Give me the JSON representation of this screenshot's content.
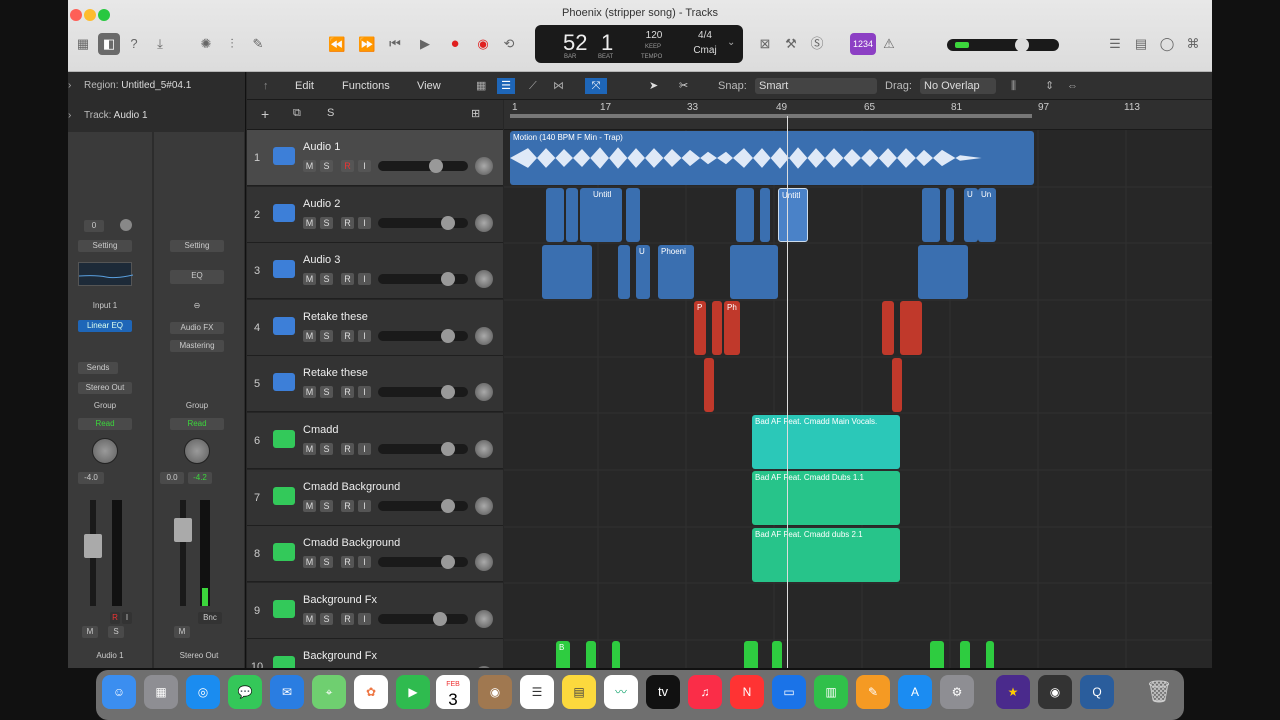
{
  "window": {
    "title": "Phoenix (stripper song) - Tracks"
  },
  "lcd": {
    "bar": "52",
    "beat": "1",
    "bar_label": "BAR",
    "beat_label": "BEAT",
    "tempo": "120",
    "keep": "KEEP",
    "tempo_label": "TEMPO",
    "signature": "4/4",
    "key": "Cmaj",
    "count_badge": "1234"
  },
  "inspector": {
    "region_prefix": "Region:",
    "region": "Untitled_5#04.1",
    "track_prefix": "Track:",
    "track": "Audio 1"
  },
  "channel_strip_1": {
    "gain": "0",
    "setting": "Setting",
    "input": "Input 1",
    "plugin": "Linear EQ",
    "sends": "Sends",
    "output": "Stereo Out",
    "group": "Group",
    "automation": "Read",
    "volume": "-4.0",
    "mute": "M",
    "solo": "S",
    "rec": "R",
    "input_mon": "I",
    "name": "Audio 1"
  },
  "channel_strip_2": {
    "setting": "Setting",
    "eq": "EQ",
    "plugin1": "Audio FX",
    "plugin2": "Mastering",
    "group": "Group",
    "automation": "Read",
    "volume": "0.0",
    "peak": "-4.2",
    "bounce": "Bnc",
    "mute": "M",
    "name": "Stereo Out"
  },
  "menu": {
    "edit": "Edit",
    "functions": "Functions",
    "view": "View",
    "snap_label": "Snap:",
    "snap_value": "Smart",
    "drag_label": "Drag:",
    "drag_value": "No Overlap"
  },
  "ruler": {
    "bars": [
      "1",
      "17",
      "33",
      "49",
      "65",
      "81",
      "97",
      "113"
    ]
  },
  "tracks": [
    {
      "num": "1",
      "name": "Audio 1",
      "type": "audio",
      "rec": true,
      "vol": 0.72
    },
    {
      "num": "2",
      "name": "Audio 2",
      "type": "audio",
      "rec": false,
      "vol": 0.85
    },
    {
      "num": "3",
      "name": "Audio 3",
      "type": "audio",
      "rec": false,
      "vol": 0.85
    },
    {
      "num": "4",
      "name": "Retake these",
      "type": "audio",
      "rec": false,
      "vol": 0.85
    },
    {
      "num": "5",
      "name": "Retake these",
      "type": "audio",
      "rec": false,
      "vol": 0.85
    },
    {
      "num": "6",
      "name": "Cmadd",
      "type": "green",
      "rec": false,
      "vol": 0.85
    },
    {
      "num": "7",
      "name": "Cmadd Background",
      "type": "green",
      "rec": false,
      "vol": 0.85
    },
    {
      "num": "8",
      "name": "Cmadd Background",
      "type": "green",
      "rec": false,
      "vol": 0.85
    },
    {
      "num": "9",
      "name": "Background Fx",
      "type": "green",
      "rec": false,
      "vol": 0.77
    },
    {
      "num": "10",
      "name": "Background Fx",
      "type": "green",
      "rec": false,
      "vol": 0.85
    }
  ],
  "track_buttons": {
    "mute": "M",
    "solo": "S",
    "rec": "R",
    "input": "I"
  },
  "regions": {
    "main": "Motion (140 BPM F Min - Trap)",
    "t2_a": "Untitl",
    "t2_b": "Untitl",
    "t2_c": "U",
    "t2_d": "Un",
    "t3_a": "U",
    "t3_b": "Phoeni",
    "t4_a": "P",
    "t4_b": "Ph",
    "t6": "Bad AF Feat. Cmadd Main Vocals.",
    "t7": "Bad AF Feat. Cmadd Dubs 1.1",
    "t8": "Bad AF Feat. Cmadd dubs 2.1",
    "t10": "B"
  },
  "colors": {
    "audio_region": "#3a6fb0",
    "audio_region_sel": "#4a82c8",
    "red_region": "#c0392b",
    "green_region": "#27c48a",
    "cyan_region": "#2bc8b8",
    "fx_region": "#2ecc40"
  },
  "dock": {
    "calendar_month": "FEB",
    "calendar_day": "3",
    "tv_label": "tv"
  }
}
